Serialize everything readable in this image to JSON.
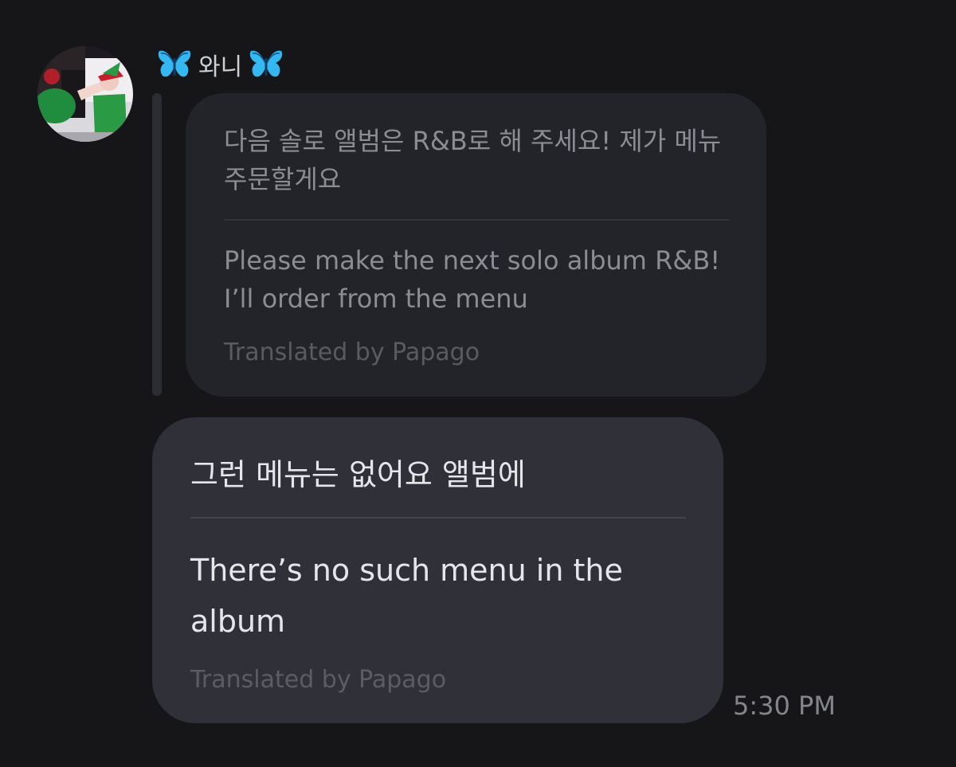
{
  "thread": {
    "sender_name": "와니",
    "sender_prefix_icon": "butterfly-emoji",
    "sender_suffix_icon": "butterfly-emoji"
  },
  "quoted_message": {
    "original_text": "다음 솔로 앨범은 R&B로 해 주세요! 제가 메뉴 주문할게요",
    "translated_text": "Please make the next solo album R&B! I’ll order from the menu",
    "translation_credit": "Translated by Papago"
  },
  "reply_message": {
    "original_text": "그런 메뉴는 없어요 앨범에",
    "translated_text": "There’s no such menu in the album",
    "translation_credit": "Translated by Papago",
    "timestamp": "5:30 PM"
  },
  "colors": {
    "background": "#161619",
    "quoted_bubble": "#232429",
    "reply_bubble": "#303138",
    "butterfly": "#35b8f2"
  }
}
